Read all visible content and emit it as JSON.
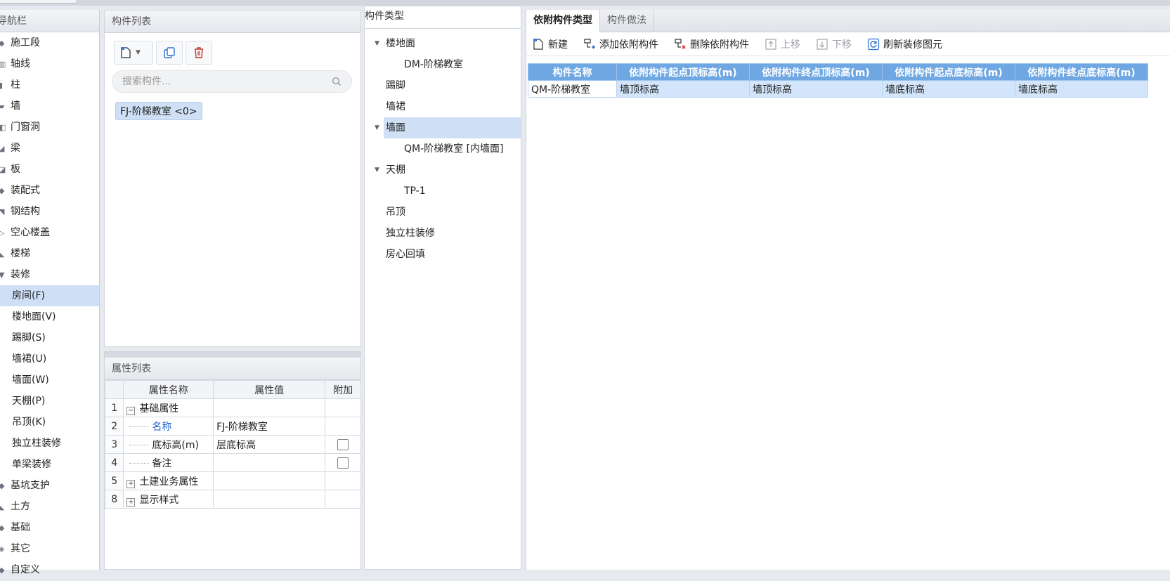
{
  "nav": {
    "title": "导航栏",
    "items": [
      {
        "label": "施工段",
        "icon": "segment-icon"
      },
      {
        "label": "轴线",
        "icon": "axis-icon"
      },
      {
        "label": "柱",
        "icon": "column-icon"
      },
      {
        "label": "墙",
        "icon": "wall-icon"
      },
      {
        "label": "门窗洞",
        "icon": "door-window-icon"
      },
      {
        "label": "梁",
        "icon": "beam-icon"
      },
      {
        "label": "板",
        "icon": "slab-icon"
      },
      {
        "label": "装配式",
        "icon": "prefab-icon"
      },
      {
        "label": "钢结构",
        "icon": "steel-icon"
      },
      {
        "label": "空心楼盖",
        "icon": "hollow-floor-icon"
      },
      {
        "label": "楼梯",
        "icon": "stairs-icon"
      },
      {
        "label": "装修",
        "icon": "decoration-icon"
      }
    ],
    "decoration_children": [
      "房间(F)",
      "楼地面(V)",
      "踢脚(S)",
      "墙裙(U)",
      "墙面(W)",
      "天棚(P)",
      "吊顶(K)",
      "独立柱装修",
      "单梁装修"
    ],
    "more_items": [
      {
        "label": "基坑支护",
        "icon": "pit-support-icon"
      },
      {
        "label": "土方",
        "icon": "earthwork-icon"
      },
      {
        "label": "基础",
        "icon": "foundation-icon"
      },
      {
        "label": "其它",
        "icon": "other-icon"
      },
      {
        "label": "自定义",
        "icon": "custom-icon"
      }
    ],
    "selected": "房间(F)"
  },
  "component_list": {
    "title": "构件列表",
    "search_placeholder": "搜索构件...",
    "selected_item": "FJ-阶梯教室 <0>"
  },
  "property_list": {
    "title": "属性列表",
    "columns": [
      "属性名称",
      "属性值",
      "附加"
    ],
    "rows": [
      {
        "num": "1",
        "name": "基础属性",
        "value": "",
        "expander": "−"
      },
      {
        "num": "2",
        "name": "名称",
        "value": "FJ-阶梯教室"
      },
      {
        "num": "3",
        "name": "底标高(m)",
        "value": "层底标高"
      },
      {
        "num": "4",
        "name": "备注",
        "value": ""
      },
      {
        "num": "5",
        "name": "土建业务属性",
        "value": "",
        "expander": "+"
      },
      {
        "num": "8",
        "name": "显示样式",
        "value": "",
        "expander": "+"
      }
    ]
  },
  "type_tree": {
    "title": "构件类型",
    "items": [
      {
        "label": "楼地面",
        "expanded": true
      },
      {
        "label": "DM-阶梯教室"
      },
      {
        "label": "踢脚"
      },
      {
        "label": "墙裙"
      },
      {
        "label": "墙面",
        "expanded": true,
        "selected": true
      },
      {
        "label": "QM-阶梯教室 [内墙面]"
      },
      {
        "label": "天棚",
        "expanded": true
      },
      {
        "label": "TP-1"
      },
      {
        "label": "吊顶"
      },
      {
        "label": "独立柱装修"
      },
      {
        "label": "房心回填"
      }
    ]
  },
  "right_panel": {
    "tabs": [
      "依附构件类型",
      "构件做法"
    ],
    "toolbar": {
      "new": "新建",
      "add_attached": "添加依附构件",
      "delete_attached": "删除依附构件",
      "move_up": "上移",
      "move_down": "下移",
      "refresh": "刷新装修图元"
    },
    "table": {
      "columns": [
        "构件名称",
        "依附构件起点顶标高(m)",
        "依附构件终点顶标高(m)",
        "依附构件起点底标高(m)",
        "依附构件终点底标高(m)"
      ],
      "rows": [
        [
          "QM-阶梯教室",
          "墙顶标高",
          "墙顶标高",
          "墙底标高",
          "墙底标高"
        ]
      ]
    }
  },
  "colors": {
    "selection": "#cfe0f6",
    "grid_header": "#6fa7e3",
    "link_blue": "#1a5fd0"
  }
}
